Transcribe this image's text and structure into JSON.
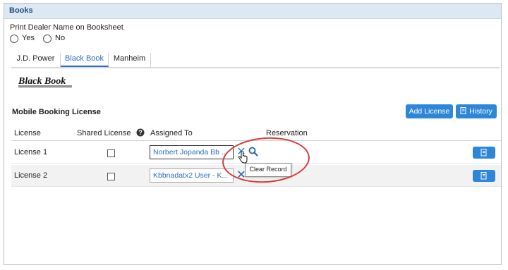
{
  "section": {
    "title": "Books"
  },
  "print_dealer": {
    "label": "Print Dealer Name on Booksheet",
    "options": [
      "Yes",
      "No"
    ]
  },
  "tabs": [
    {
      "label": "J.D. Power",
      "active": false
    },
    {
      "label": "Black Book",
      "active": true
    },
    {
      "label": "Manheim",
      "active": false
    }
  ],
  "logo": {
    "text": "Black Book"
  },
  "mobile_booking": {
    "title": "Mobile Booking License",
    "add_button": "Add License",
    "history_button": "History"
  },
  "table": {
    "headers": {
      "license": "License",
      "shared": "Shared License",
      "assigned": "Assigned To",
      "reservation": "Reservation"
    },
    "rows": [
      {
        "license": "License 1",
        "assigned": "Norbert Jopanda Bb ..."
      },
      {
        "license": "License 2",
        "assigned": "Kbbnadatx2 User - K..."
      }
    ]
  },
  "tooltip": {
    "text": "Clear Record"
  },
  "colors": {
    "accent": "#2e86d9",
    "header_bg": "#dde8f3",
    "highlight": "#d93a3a",
    "link": "#2a6fbf"
  },
  "icons": {
    "clear": "close-icon",
    "search": "search-icon",
    "history": "document-icon",
    "help": "help-icon",
    "row_action": "document-icon"
  }
}
